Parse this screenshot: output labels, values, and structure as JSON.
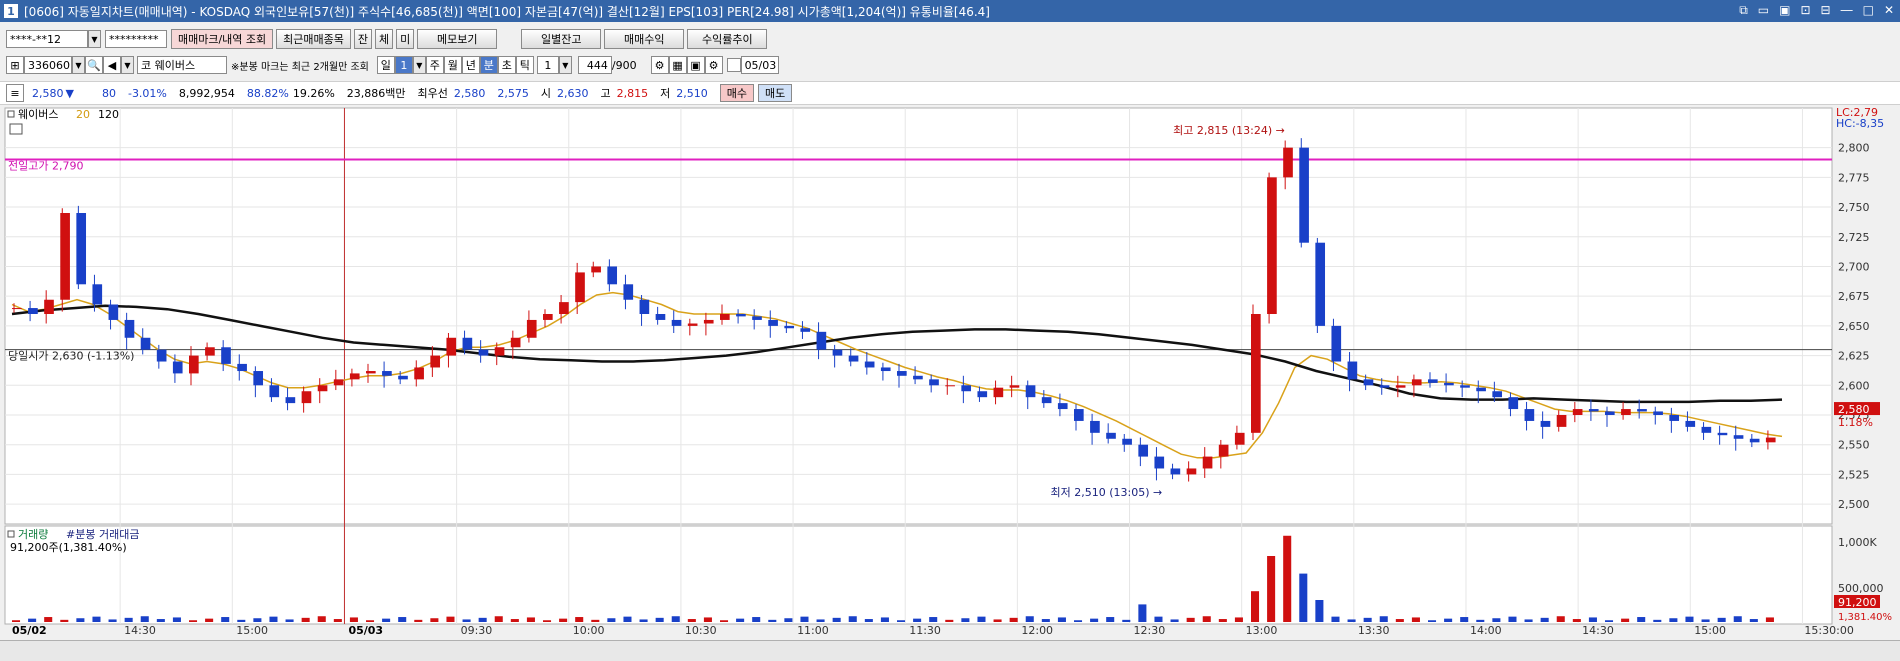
{
  "window": {
    "title_num": "1",
    "title": "[0606] 자동일지차트(매매내역) - KOSDAQ 외국인보유[57(천)] 주식수[46,685(천)] 액면[100] 자본금[47(억)] 결산[12월] EPS[103] PER[24.98] 시가총액[1,204(억)] 유통비율[46.4]",
    "controls": [
      "⧉",
      "▭",
      "▣",
      "⊡",
      "⊟",
      "―",
      "□",
      "✕"
    ]
  },
  "toolbar1": {
    "account": "****-**12",
    "password": "*********",
    "buttons": [
      "매매마크/내역 조회",
      "최근매매종목",
      "잔",
      "체",
      "미",
      "메모보기",
      "일별잔고",
      "매매수익",
      "수익률추이"
    ]
  },
  "toolbar2": {
    "code": "336060",
    "market_label": "코",
    "stock_name": "웨이버스",
    "note": "※분봉 마크는 최근 2개월만 조회",
    "periods": [
      "일",
      "1",
      "주",
      "월",
      "년",
      "분",
      "초",
      "틱"
    ],
    "period_selected": "분",
    "interval": "1",
    "count": "444",
    "count_max": "/900",
    "date": "05/03"
  },
  "quote": {
    "price": "2,580",
    "arrow": "▼",
    "change": "80",
    "change_pct": "-3.01%",
    "volume": "8,992,954",
    "pct1": "88.82%",
    "pct2": "19.26%",
    "amount": "23,886백만",
    "best_label": "최우선",
    "ask": "2,580",
    "bid": "2,575",
    "open_label": "시",
    "open": "2,630",
    "high_label": "고",
    "high": "2,815",
    "low_label": "저",
    "low": "2,510",
    "buy_btn": "매수",
    "sell_btn": "매도"
  },
  "chart_data": {
    "type": "candlestick",
    "legend": {
      "name": "웨이버스",
      "ma1": "20",
      "ma2": "120"
    },
    "ylim": [
      2490,
      2830
    ],
    "yticks": [
      "2,800",
      "2,775",
      "2,750",
      "2,725",
      "2,700",
      "2,675",
      "2,650",
      "2,625",
      "2,600",
      "2,575",
      "2,550",
      "2,525",
      "2,500"
    ],
    "x_labels": [
      "05/02",
      "14:30",
      "15:00",
      "05/03",
      "09:30",
      "10:00",
      "10:30",
      "11:00",
      "11:30",
      "12:00",
      "12:30",
      "13:00",
      "13:30",
      "14:00",
      "14:30",
      "15:00",
      "15:30:00"
    ],
    "lc_label": "LC:2,79",
    "hc_label": "HC:-8,35",
    "prev_high_label": "전일고가 2,790",
    "prev_high": 2790,
    "open_label": "당일시가 2,630 (-1.13%)",
    "open_price": 2630,
    "high_annot": "최고 2,815 (13:24)",
    "low_annot": "최저 2,510 (13:05)",
    "current_price": "2,580",
    "current_pct": "1.18%",
    "price_path": [
      2665,
      2660,
      2672,
      2745,
      2685,
      2668,
      2655,
      2640,
      2630,
      2620,
      2610,
      2625,
      2632,
      2618,
      2612,
      2600,
      2590,
      2585,
      2595,
      2600,
      2605,
      2610,
      2612,
      2608,
      2605,
      2615,
      2625,
      2640,
      2630,
      2625,
      2632,
      2640,
      2655,
      2660,
      2670,
      2695,
      2700,
      2685,
      2672,
      2660,
      2655,
      2650,
      2652,
      2655,
      2660,
      2658,
      2655,
      2650,
      2648,
      2645,
      2630,
      2625,
      2620,
      2615,
      2612,
      2608,
      2605,
      2600,
      2600,
      2595,
      2590,
      2598,
      2600,
      2590,
      2585,
      2580,
      2570,
      2560,
      2555,
      2550,
      2540,
      2530,
      2525,
      2530,
      2540,
      2550,
      2560,
      2660,
      2775,
      2800,
      2720,
      2650,
      2620,
      2605,
      2600,
      2598,
      2600,
      2605,
      2602,
      2600,
      2598,
      2595,
      2590,
      2580,
      2570,
      2565,
      2575,
      2580,
      2578,
      2575,
      2580,
      2578,
      2575,
      2570,
      2565,
      2560,
      2558,
      2555,
      2552,
      2556
    ],
    "ma20_path": [
      2668,
      2662,
      2664,
      2668,
      2672,
      2668,
      2660,
      2650,
      2640,
      2630,
      2622,
      2618,
      2620,
      2618,
      2614,
      2608,
      2602,
      2598,
      2598,
      2600,
      2603,
      2606,
      2608,
      2608,
      2610,
      2614,
      2620,
      2628,
      2632,
      2632,
      2634,
      2638,
      2644,
      2650,
      2658,
      2668,
      2676,
      2678,
      2676,
      2672,
      2668,
      2662,
      2660,
      2660,
      2660,
      2660,
      2658,
      2656,
      2652,
      2648,
      2642,
      2636,
      2630,
      2625,
      2620,
      2615,
      2611,
      2607,
      2604,
      2600,
      2597,
      2596,
      2596,
      2594,
      2591,
      2587,
      2582,
      2576,
      2570,
      2563,
      2556,
      2549,
      2542,
      2539,
      2539,
      2541,
      2543,
      2560,
      2585,
      2615,
      2625,
      2622,
      2615,
      2608,
      2605,
      2603,
      2602,
      2602,
      2603,
      2602,
      2600,
      2598,
      2595,
      2590,
      2585,
      2580,
      2578,
      2578,
      2578,
      2577,
      2577,
      2577,
      2576,
      2574,
      2571,
      2568,
      2565,
      2562,
      2559,
      2557
    ],
    "ma120_path": [
      2660,
      2663,
      2665,
      2667,
      2666,
      2664,
      2660,
      2655,
      2650,
      2645,
      2640,
      2636,
      2634,
      2632,
      2630,
      2627,
      2624,
      2622,
      2621,
      2620,
      2620,
      2621,
      2623,
      2625,
      2628,
      2632,
      2636,
      2640,
      2643,
      2645,
      2646,
      2647,
      2647,
      2646,
      2645,
      2643,
      2640,
      2637,
      2634,
      2630,
      2626,
      2620,
      2612,
      2606,
      2600,
      2593,
      2589,
      2588,
      2588,
      2589,
      2588,
      2587,
      2586,
      2586,
      2586,
      2587,
      2587,
      2588
    ],
    "volume_legend": "거래량",
    "volume_legend2": "#분봉 거래대금",
    "volume_label": "91,200주(1,381.40%)",
    "vol_ticks": [
      "1,000K",
      "500,000"
    ],
    "vol_current": "91,200",
    "vol_current_pct": "1,381.40%",
    "volume_max": 1000000
  }
}
